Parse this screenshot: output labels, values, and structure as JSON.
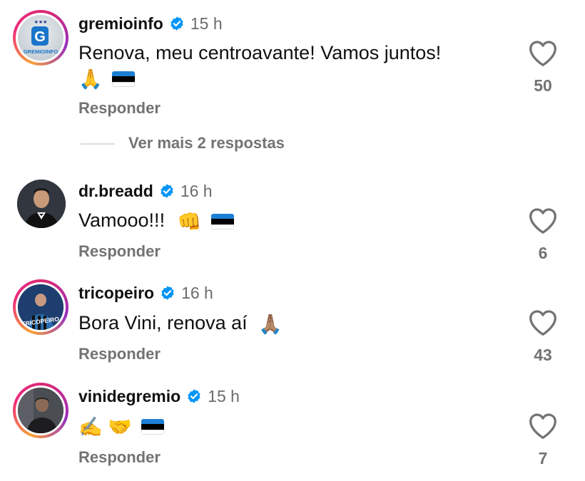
{
  "comments": [
    {
      "username": "gremioinfo",
      "time": "15 h",
      "text_line1": "Renova, meu centroavante! Vamos juntos!",
      "emojis": [
        "🙏",
        "flag"
      ],
      "reply_label": "Responder",
      "likes": "50",
      "avatar_label": "GREMIOINFO"
    },
    {
      "username": "dr.breadd",
      "time": "16 h",
      "text": "Vamooo!!!",
      "emojis": [
        "👊",
        "flag"
      ],
      "reply_label": "Responder",
      "likes": "6"
    },
    {
      "username": "tricopeiro",
      "time": "16 h",
      "text": "Bora Vini, renova aí",
      "emojis": [
        "🙏🏽"
      ],
      "reply_label": "Responder",
      "likes": "43",
      "avatar_label": "TRICOPEIRO"
    },
    {
      "username": "vinidegremio",
      "time": "15 h",
      "emojis": [
        "✍️",
        "🤝",
        "flag"
      ],
      "reply_label": "Responder",
      "likes": "7"
    }
  ],
  "view_more_replies": "Ver mais 2 respostas",
  "colors": {
    "flag_blue": "#1b7fd4",
    "flag_black": "#000000",
    "flag_white": "#ffffff",
    "verified": "#0095f6",
    "muted": "#737373"
  }
}
